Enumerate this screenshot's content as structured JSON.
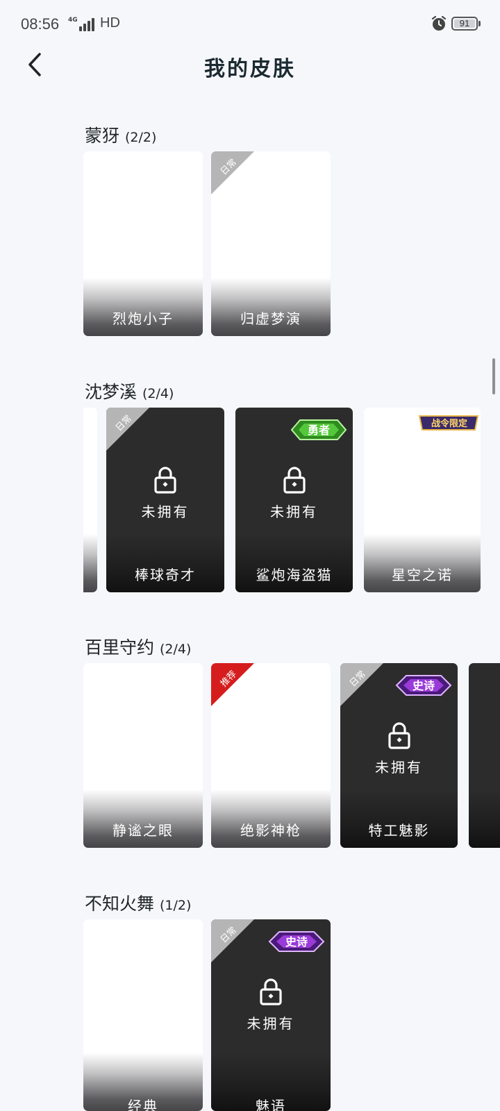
{
  "status_bar": {
    "time": "08:56",
    "network": "4G",
    "hd": "HD",
    "battery": "91"
  },
  "header": {
    "title": "我的皮肤"
  },
  "sections": [
    {
      "title": "蒙犽",
      "count": "(2/2)",
      "cards": [
        {
          "name": "烈炮小子"
        },
        {
          "name": "归虚梦演",
          "tag": "日常"
        }
      ]
    },
    {
      "title": "沈梦溪",
      "count": "(2/4)",
      "cards": [
        {
          "name": "棒球奇才",
          "tag": "日常",
          "status": "未拥有"
        },
        {
          "name": "鲨炮海盗猫",
          "badge": "勇者",
          "status": "未拥有"
        },
        {
          "name": "星空之诺",
          "badge": "战令限定"
        }
      ]
    },
    {
      "title": "百里守约",
      "count": "(2/4)",
      "cards": [
        {
          "name": "静谧之眼"
        },
        {
          "name": "绝影神枪",
          "tag": "推荐"
        },
        {
          "name": "特工魅影",
          "tag": "日常",
          "badge": "史诗",
          "status": "未拥有"
        }
      ]
    },
    {
      "title": "不知火舞",
      "count": "(1/2)",
      "cards": [
        {
          "name": "经典"
        },
        {
          "name": "魅语",
          "tag": "日常",
          "badge": "史诗",
          "status": "未拥有"
        }
      ]
    }
  ],
  "colors": {
    "background": "#f5f7fb",
    "locked_card": "#2c2c2c",
    "recommend_tag": "#d61d1d",
    "daily_tag": "#b5b5b5",
    "brave_badge": "#3fa52a",
    "epic_badge": "#7a2bb5"
  },
  "icons": [
    "back-icon",
    "alarm-icon",
    "signal-icon",
    "battery-icon",
    "lock-icon"
  ]
}
